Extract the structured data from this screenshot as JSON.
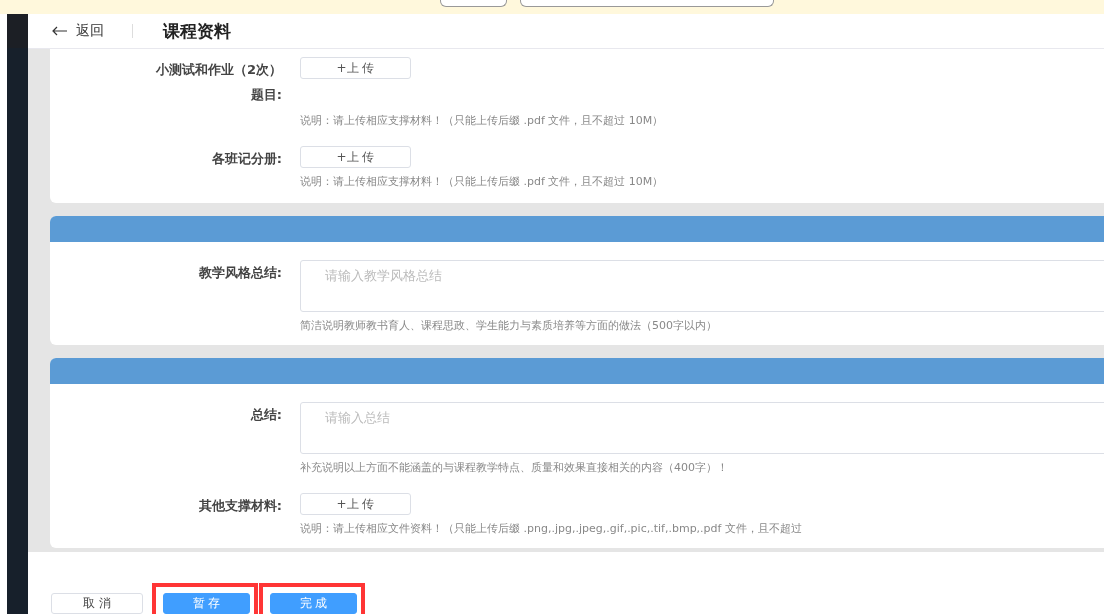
{
  "header": {
    "back": "返回",
    "title": "课程资料"
  },
  "sections": [
    {
      "kind": "plain",
      "rows": [
        {
          "kind": "upload",
          "label": [
            "小测试和作业（2次）",
            "题目:"
          ],
          "button": "+上 传",
          "note": "说明：请上传相应支撑材料！（只能上传后缀 .pdf 文件，且不超过 10M）"
        },
        {
          "kind": "upload",
          "label": [
            "各班记分册:"
          ],
          "button": "+上 传",
          "note": "说明：请上传相应支撑材料！（只能上传后缀 .pdf 文件，且不超过 10M）"
        }
      ]
    },
    {
      "kind": "titled",
      "rows": [
        {
          "kind": "textarea",
          "label": [
            "教学风格总结:"
          ],
          "placeholder": "请输入教学风格总结",
          "note": "简洁说明教师教书育人、课程思政、学生能力与素质培养等方面的做法（500字以内）"
        }
      ]
    },
    {
      "kind": "titled",
      "rows": [
        {
          "kind": "textarea",
          "label": [
            "总结:"
          ],
          "placeholder": "请输入总结",
          "note": "补充说明以上方面不能涵盖的与课程教学特点、质量和效果直接相关的内容（400字）！"
        },
        {
          "kind": "upload",
          "label": [
            "其他支撑材料:"
          ],
          "button": "+上 传",
          "note": "说明：请上传相应文件资料！（只能上传后缀 .png,.jpg,.jpeg,.gif,.pic,.tif,.bmp,.pdf 文件，且不超过"
        }
      ]
    }
  ],
  "footer": {
    "buttons": [
      {
        "label": "取 消",
        "kind": "default",
        "highlighted": false
      },
      {
        "label": "暂 存",
        "kind": "primary",
        "highlighted": true
      },
      {
        "label": "完 成",
        "kind": "primary",
        "highlighted": true
      }
    ]
  }
}
